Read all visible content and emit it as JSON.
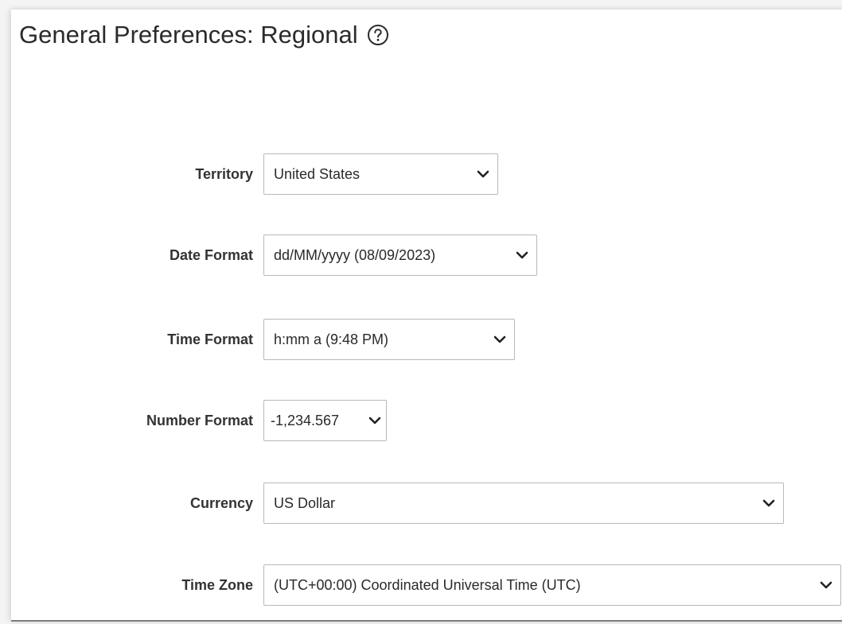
{
  "page": {
    "title": "General Preferences: Regional",
    "help_icon": "question-circle-icon"
  },
  "fields": {
    "territory": {
      "label": "Territory",
      "value": "United States"
    },
    "date_format": {
      "label": "Date Format",
      "value": "dd/MM/yyyy (08/09/2023)"
    },
    "time_format": {
      "label": "Time Format",
      "value": "h:mm a (9:48 PM)"
    },
    "number_format": {
      "label": "Number Format",
      "value": "-1,234.567"
    },
    "currency": {
      "label": "Currency",
      "value": "US Dollar"
    },
    "time_zone": {
      "label": "Time Zone",
      "value": "(UTC+00:00) Coordinated Universal Time (UTC)"
    }
  },
  "icons": {
    "dropdown": "chevron-down-icon"
  },
  "colors": {
    "border": "#b8b8b8",
    "text": "#202020",
    "background": "#ffffff"
  }
}
